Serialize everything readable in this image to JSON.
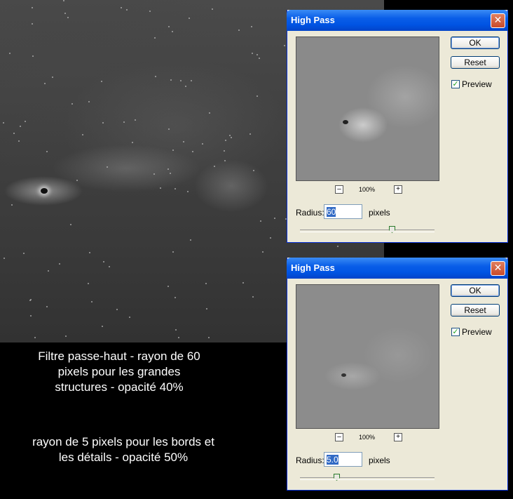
{
  "caption": {
    "block1": [
      "Filtre passe-haut - rayon de 60",
      "pixels pour les grandes",
      "structures - opacité 40%"
    ],
    "block2": [
      "rayon de 5 pixels pour les bords et",
      "les détails - opacité 50%"
    ]
  },
  "dialogs": [
    {
      "title": "High Pass",
      "close_glyph": "✕",
      "ok_label": "OK",
      "reset_label": "Reset",
      "preview_label": "Preview",
      "preview_checked": true,
      "zoom_minus": "–",
      "zoom_plus": "+",
      "zoom_level": "100%",
      "radius_label": "Radius:",
      "radius_value": "60",
      "radius_unit": "pixels",
      "slider_fraction": 0.68
    },
    {
      "title": "High Pass",
      "close_glyph": "✕",
      "ok_label": "OK",
      "reset_label": "Reset",
      "preview_label": "Preview",
      "preview_checked": true,
      "zoom_minus": "–",
      "zoom_plus": "+",
      "zoom_level": "100%",
      "radius_label": "Radius:",
      "radius_value": "5.0",
      "radius_unit": "pixels",
      "slider_fraction": 0.27
    }
  ],
  "colors": {
    "titlebar": "#0054e3",
    "dialog_bg": "#ece9d8",
    "close_button": "#c94a2a",
    "selection": "#316ac5"
  }
}
